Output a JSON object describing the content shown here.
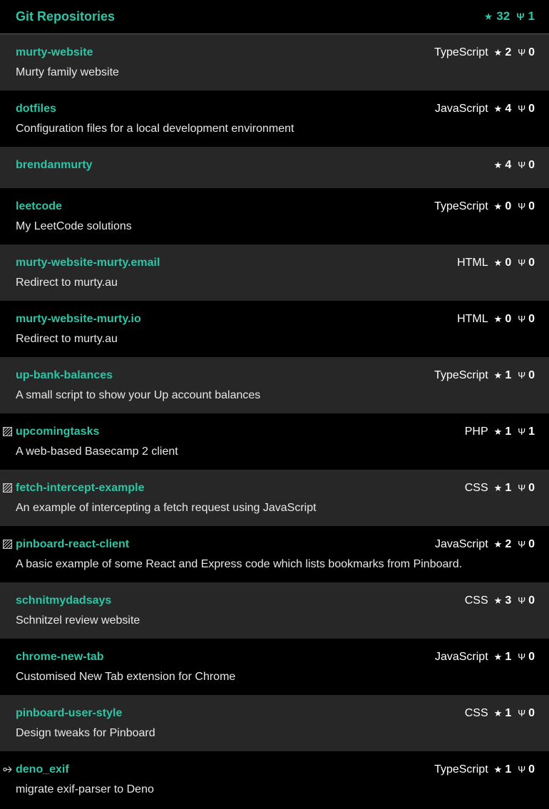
{
  "header": {
    "title": "Git Repositories",
    "stars": "32",
    "forks": "1",
    "star_glyph": "★",
    "fork_glyph": "Ψ"
  },
  "colors": {
    "accent": "#2ec4a6",
    "row_dark": "#000000",
    "row_light": "#272727",
    "text": "#e8e8e8"
  },
  "icons": {
    "star": "star-icon",
    "fork": "fork-icon",
    "archived": "archived-repo-icon",
    "forked": "forked-repo-icon"
  },
  "repos": [
    {
      "name": "murty-website",
      "description": "Murty family website",
      "language": "TypeScript",
      "stars": "2",
      "forks": "0",
      "marker": ""
    },
    {
      "name": "dotfiles",
      "description": "Configuration files for a local development environment",
      "language": "JavaScript",
      "stars": "4",
      "forks": "0",
      "marker": ""
    },
    {
      "name": "brendanmurty",
      "description": "",
      "language": "",
      "stars": "4",
      "forks": "0",
      "marker": ""
    },
    {
      "name": "leetcode",
      "description": "My LeetCode solutions",
      "language": "TypeScript",
      "stars": "0",
      "forks": "0",
      "marker": ""
    },
    {
      "name": "murty-website-murty.email",
      "description": "Redirect to murty.au",
      "language": "HTML",
      "stars": "0",
      "forks": "0",
      "marker": ""
    },
    {
      "name": "murty-website-murty.io",
      "description": "Redirect to murty.au",
      "language": "HTML",
      "stars": "0",
      "forks": "0",
      "marker": ""
    },
    {
      "name": "up-bank-balances",
      "description": "A small script to show your Up account balances",
      "language": "TypeScript",
      "stars": "1",
      "forks": "0",
      "marker": ""
    },
    {
      "name": "upcomingtasks",
      "description": "A web-based Basecamp 2 client",
      "language": "PHP",
      "stars": "1",
      "forks": "1",
      "marker": "archived"
    },
    {
      "name": "fetch-intercept-example",
      "description": "An example of intercepting a fetch request using JavaScript",
      "language": "CSS",
      "stars": "1",
      "forks": "0",
      "marker": "archived"
    },
    {
      "name": "pinboard-react-client",
      "description": "A basic example of some React and Express code which lists bookmarks from Pinboard.",
      "language": "JavaScript",
      "stars": "2",
      "forks": "0",
      "marker": "archived"
    },
    {
      "name": "schnitmydadsays",
      "description": "Schnitzel review website",
      "language": "CSS",
      "stars": "3",
      "forks": "0",
      "marker": ""
    },
    {
      "name": "chrome-new-tab",
      "description": "Customised New Tab extension for Chrome",
      "language": "JavaScript",
      "stars": "1",
      "forks": "0",
      "marker": ""
    },
    {
      "name": "pinboard-user-style",
      "description": "Design tweaks for Pinboard",
      "language": "CSS",
      "stars": "1",
      "forks": "0",
      "marker": ""
    },
    {
      "name": "deno_exif",
      "description": "migrate exif-parser to Deno",
      "language": "TypeScript",
      "stars": "1",
      "forks": "0",
      "marker": "forked"
    }
  ]
}
